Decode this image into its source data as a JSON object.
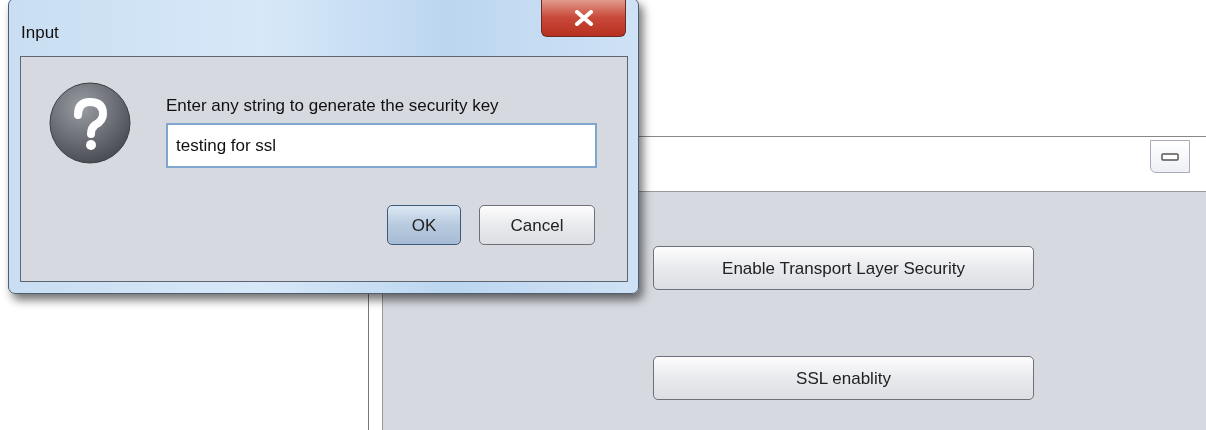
{
  "back_window": {
    "buttons": [
      {
        "label": "Enable Transport Layer Security"
      },
      {
        "label": "SSL enablity"
      }
    ]
  },
  "dialog": {
    "title": "Input",
    "prompt": "Enter any string to generate the security key",
    "field": {
      "value": "testing for ssl"
    },
    "buttons": [
      {
        "label": "OK",
        "default": true
      },
      {
        "label": "Cancel",
        "default": false
      }
    ]
  }
}
